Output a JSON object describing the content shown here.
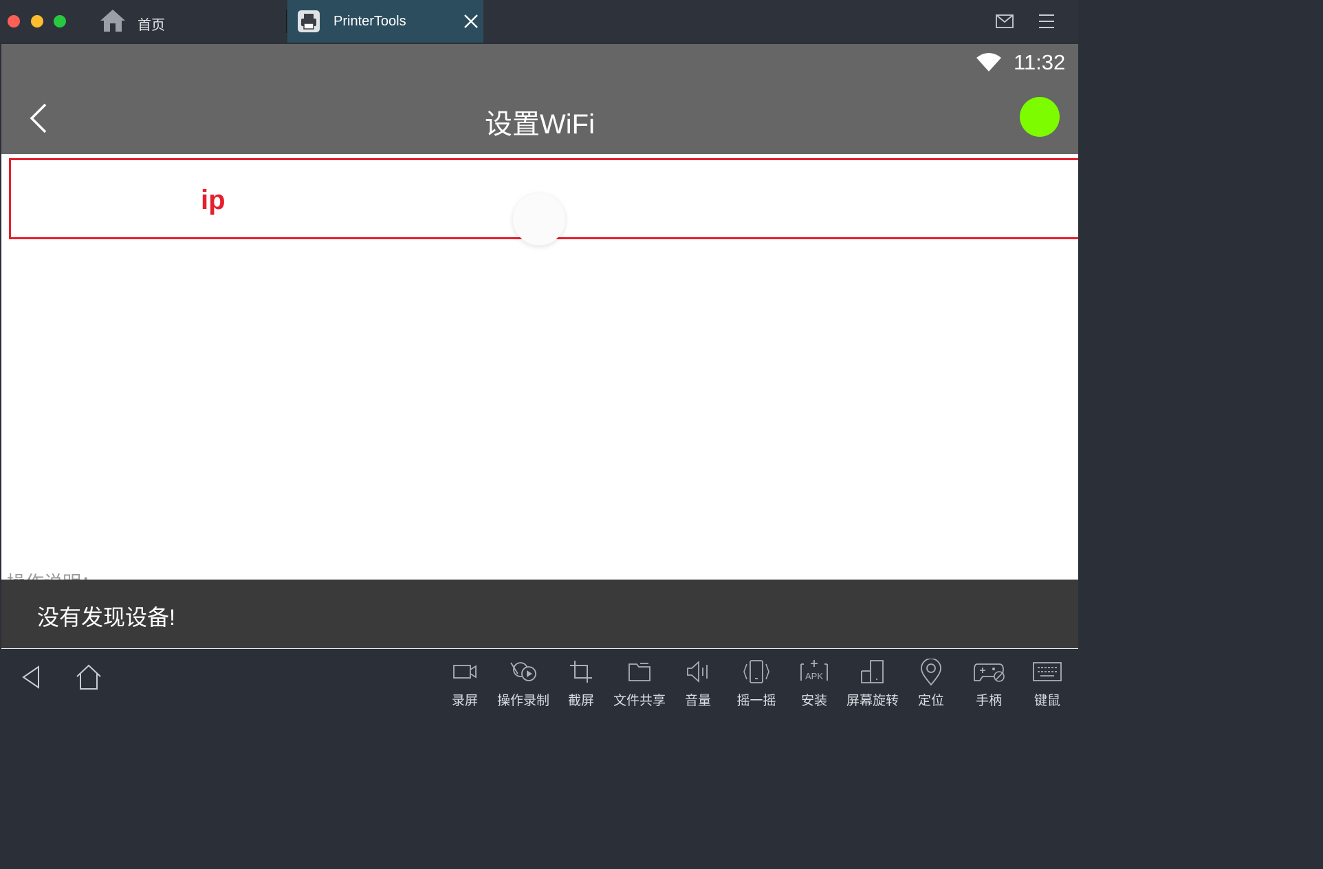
{
  "window": {
    "tabs": [
      {
        "label": "首页",
        "icon": "home-icon",
        "active": false
      },
      {
        "label": "PrinterTools",
        "icon": "printer-app-icon",
        "active": true
      }
    ],
    "right_icons": [
      "mail-icon",
      "menu-icon"
    ]
  },
  "status_bar": {
    "time": "11:32",
    "wifi": "wifi-icon"
  },
  "app_bar": {
    "title": "设置WiFi",
    "status_color": "#7dfc00"
  },
  "ip_row": {
    "label": "ip"
  },
  "instructions_label": "操作说明：",
  "toast": {
    "message": "没有发现设备!"
  },
  "toolbar": {
    "nav": [
      "back-triangle-icon",
      "home-outline-icon"
    ],
    "tools": [
      {
        "label": "录屏",
        "icon": "video-camera-icon"
      },
      {
        "label": "操作录制",
        "icon": "macro-record-icon"
      },
      {
        "label": "截屏",
        "icon": "crop-icon"
      },
      {
        "label": "文件共享",
        "icon": "folder-icon"
      },
      {
        "label": "音量",
        "icon": "volume-icon"
      },
      {
        "label": "摇一摇",
        "icon": "shake-phone-icon"
      },
      {
        "label": "安装",
        "icon": "apk-install-icon"
      },
      {
        "label": "屏幕旋转",
        "icon": "rotate-screen-icon"
      },
      {
        "label": "定位",
        "icon": "location-pin-icon"
      },
      {
        "label": "手柄",
        "icon": "gamepad-icon"
      },
      {
        "label": "键鼠",
        "icon": "keyboard-icon"
      }
    ]
  }
}
